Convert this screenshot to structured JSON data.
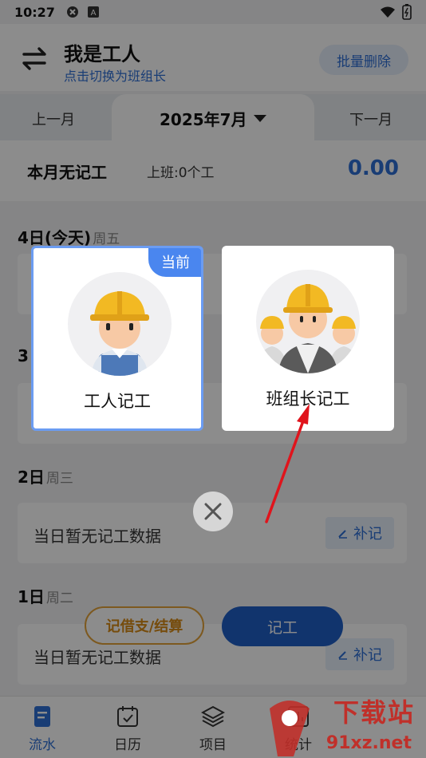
{
  "status_bar": {
    "time": "10:27"
  },
  "header": {
    "role_title": "我是工人",
    "role_switch_hint": "点击切换为班组长",
    "batch_delete_label": "批量删除"
  },
  "month_nav": {
    "prev_label": "上一月",
    "current_label": "2025年7月",
    "next_label": "下一月"
  },
  "summary": {
    "no_record_label": "本月无记工",
    "shift_text": "上班:0个工",
    "amount": "0.00"
  },
  "days": [
    {
      "label": "4日(今天)",
      "weekday": "周五"
    },
    {
      "label": "3"
    },
    {
      "label": "2日",
      "weekday": "周三",
      "empty_text": "当日暂无记工数据",
      "supplement_label": "补记"
    },
    {
      "label": "1日",
      "weekday": "周二",
      "empty_text": "当日暂无记工数据",
      "supplement_label": "补记"
    }
  ],
  "actions": {
    "loan_label": "记借支/结算",
    "record_label": "记工"
  },
  "tabbar": {
    "items": [
      {
        "label": "流水",
        "active": true
      },
      {
        "label": "日历"
      },
      {
        "label": "项目"
      },
      {
        "label": "统计"
      }
    ]
  },
  "role_picker": {
    "worker": {
      "label": "工人记工",
      "badge": "当前"
    },
    "leader": {
      "label": "班组长记工"
    }
  },
  "watermark": {
    "brand": "下载站",
    "url": "91xz.net"
  },
  "colors": {
    "accent": "#2f6fd6",
    "warning": "#d78a17",
    "arrow": "#e0141c"
  }
}
